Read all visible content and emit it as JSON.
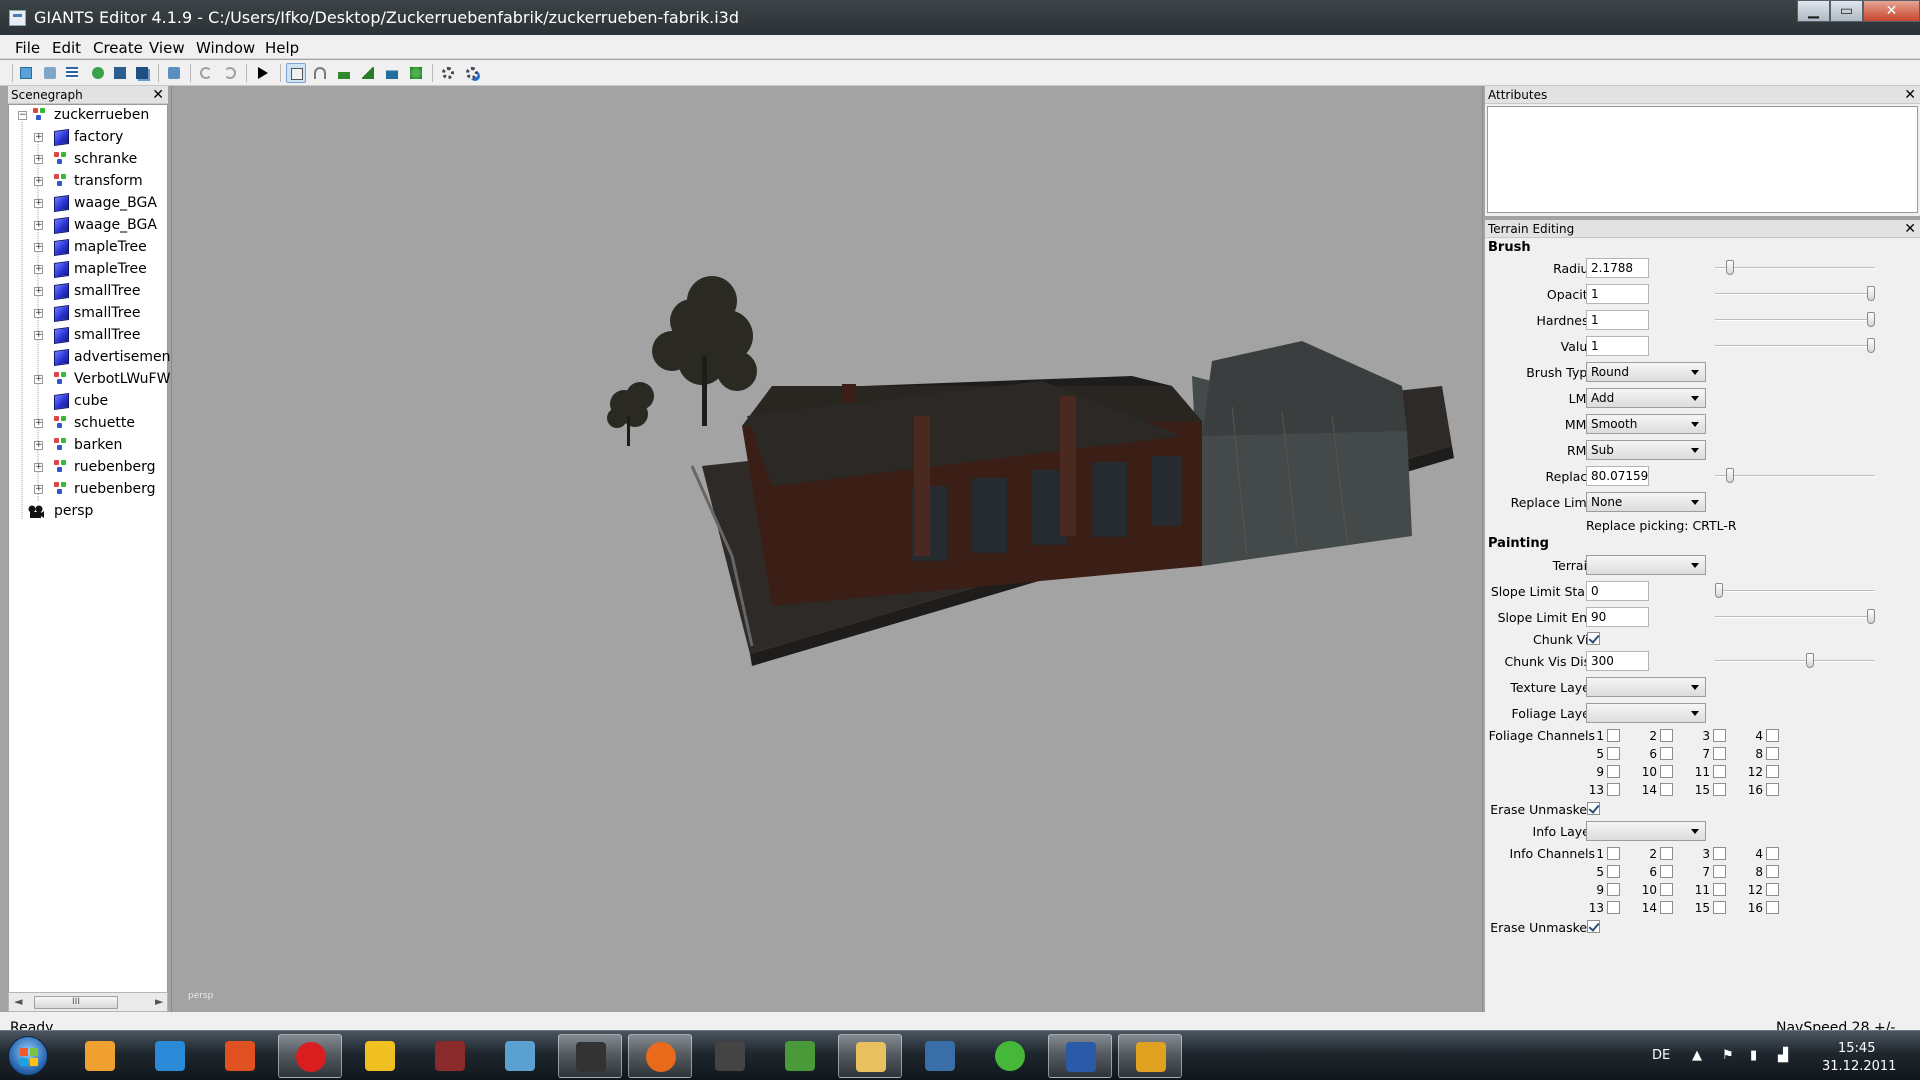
{
  "window": {
    "title": "GIANTS Editor 4.1.9 - C:/Users/Ifko/Desktop/Zuckerruebenfabrik/zuckerrueben-fabrik.i3d",
    "minimize": "▁",
    "maximize": "▭",
    "close": "✕"
  },
  "menu": {
    "file": "File",
    "edit": "Edit",
    "create": "Create",
    "view": "View",
    "window": "Window",
    "help": "Help"
  },
  "scenegraph": {
    "title": "Scenegraph",
    "close": "✕",
    "root": "zuckerrueben",
    "items": [
      {
        "label": "factory",
        "icon": "cube",
        "expandable": true
      },
      {
        "label": "schranke",
        "icon": "transform",
        "expandable": true
      },
      {
        "label": "transform",
        "icon": "transform",
        "expandable": true
      },
      {
        "label": "waage_BGA",
        "icon": "cube",
        "expandable": true
      },
      {
        "label": "waage_BGA",
        "icon": "cube",
        "expandable": true
      },
      {
        "label": "mapleTree",
        "icon": "cube",
        "expandable": true
      },
      {
        "label": "mapleTree",
        "icon": "cube",
        "expandable": true
      },
      {
        "label": "smallTree",
        "icon": "cube",
        "expandable": true
      },
      {
        "label": "smallTree",
        "icon": "cube",
        "expandable": true
      },
      {
        "label": "smallTree",
        "icon": "cube",
        "expandable": true
      },
      {
        "label": "advertisemen",
        "icon": "cube",
        "expandable": false
      },
      {
        "label": "VerbotLWuFW",
        "icon": "transform",
        "expandable": true
      },
      {
        "label": "cube",
        "icon": "cube",
        "expandable": false
      },
      {
        "label": "schuette",
        "icon": "transform",
        "expandable": true
      },
      {
        "label": "barken",
        "icon": "transform",
        "expandable": true
      },
      {
        "label": "ruebenberg",
        "icon": "transform",
        "expandable": true
      },
      {
        "label": "ruebenberg",
        "icon": "transform",
        "expandable": true
      }
    ],
    "camera": "persp",
    "scroll_thumb": "III"
  },
  "viewport": {
    "label": "persp"
  },
  "attributes": {
    "title": "Attributes",
    "close": "✕"
  },
  "terrain": {
    "title": "Terrain Editing",
    "close": "✕",
    "brush_section": "Brush",
    "radius_label": "Radius",
    "radius": "2.1788",
    "radius_slider": 0.07,
    "opacity_label": "Opacity",
    "opacity": "1",
    "opacity_slider": 1.0,
    "hardness_label": "Hardness",
    "hardness": "1",
    "hardness_slider": 1.0,
    "value_label": "Value",
    "value": "1",
    "value_slider": 1.0,
    "brush_type_label": "Brush Type",
    "brush_type": "Round",
    "lmb_label": "LMB",
    "lmb": "Add",
    "mmb_label": "MMB",
    "mmb": "Smooth",
    "rmb_label": "RMB",
    "rmb": "Sub",
    "replace_label": "Replace",
    "replace": "80.07159",
    "replace_slider": 0.07,
    "replace_limit_label": "Replace Limit",
    "replace_limit": "None",
    "replace_picking": "Replace picking: CRTL-R",
    "painting_section": "Painting",
    "terrain_label": "Terrain",
    "terrain_value": "",
    "slope_start_label": "Slope Limit Start",
    "slope_start": "0",
    "slope_start_slider": 0.0,
    "slope_end_label": "Slope Limit End",
    "slope_end": "90",
    "slope_end_slider": 1.0,
    "chunk_vis_label": "Chunk Vis",
    "chunk_vis": true,
    "chunk_vis_dist_label": "Chunk Vis Dist",
    "chunk_vis_dist": "300",
    "chunk_vis_dist_slider": 0.6,
    "texture_layer_label": "Texture Layer",
    "texture_layer": "",
    "foliage_layer_label": "Foliage Layer",
    "foliage_layer": "",
    "foliage_channels_label": "Foliage Channels",
    "channel_numbers": [
      "1",
      "2",
      "3",
      "4",
      "5",
      "6",
      "7",
      "8",
      "9",
      "10",
      "11",
      "12",
      "13",
      "14",
      "15",
      "16"
    ],
    "erase_unmasked_label": "Erase Unmasked",
    "erase_unmasked_1": true,
    "info_layer_label": "Info Layer",
    "info_layer": "",
    "info_channels_label": "Info Channels",
    "erase_unmasked_2": true
  },
  "status": {
    "left": "Ready",
    "right": "NavSpeed 28 +/-"
  },
  "taskbar": {
    "items": [
      "media-player",
      "internet-explorer",
      "paint-app",
      "opera",
      "winamp",
      "tractor-game",
      "paint-palette",
      "agent-app",
      "firefox",
      "tractor-mod",
      "fendt-tractor",
      "explorer-folder",
      "giants-monitor",
      "icq",
      "editor-app-blue",
      "editor-app-yellow"
    ],
    "lang": "DE",
    "time": "15:45",
    "date": "31.12.2011"
  },
  "colors": {
    "viewport_bg": "#a3a3a3",
    "taskbar": "#1f272e",
    "titlebar": "#33393d",
    "cube_icon": "#2c35d6"
  }
}
